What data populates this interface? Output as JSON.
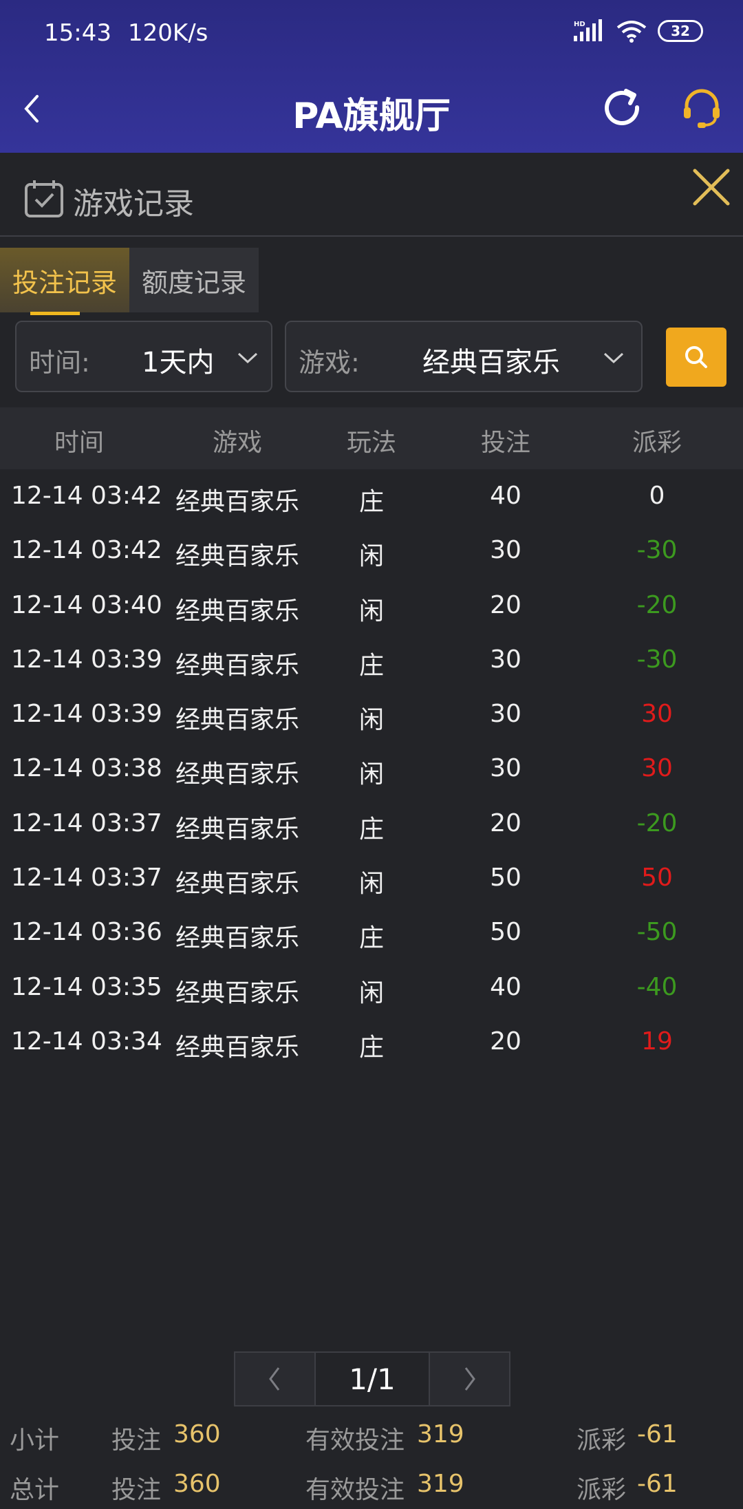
{
  "status_bar": {
    "time": "15:43",
    "network_speed": "120K/s",
    "battery": "32",
    "signal_badge": "HD"
  },
  "nav": {
    "title": "PA旗舰厅"
  },
  "section": {
    "title": "游戏记录"
  },
  "tabs": [
    {
      "label": "投注记录",
      "active": true
    },
    {
      "label": "额度记录",
      "active": false
    }
  ],
  "filters": {
    "time": {
      "label": "时间:",
      "value": "1天内"
    },
    "game": {
      "label": "游戏:",
      "value": "经典百家乐"
    }
  },
  "table": {
    "headers": [
      "时间",
      "游戏",
      "玩法",
      "投注",
      "派彩"
    ],
    "rows": [
      {
        "time": "12-14 03:42",
        "game": "经典百家乐",
        "play": "庄",
        "bet": "40",
        "payout": "0",
        "sign": "zero"
      },
      {
        "time": "12-14 03:42",
        "game": "经典百家乐",
        "play": "闲",
        "bet": "30",
        "payout": "-30",
        "sign": "neg"
      },
      {
        "time": "12-14 03:40",
        "game": "经典百家乐",
        "play": "闲",
        "bet": "20",
        "payout": "-20",
        "sign": "neg"
      },
      {
        "time": "12-14 03:39",
        "game": "经典百家乐",
        "play": "庄",
        "bet": "30",
        "payout": "-30",
        "sign": "neg"
      },
      {
        "time": "12-14 03:39",
        "game": "经典百家乐",
        "play": "闲",
        "bet": "30",
        "payout": "30",
        "sign": "pos"
      },
      {
        "time": "12-14 03:38",
        "game": "经典百家乐",
        "play": "闲",
        "bet": "30",
        "payout": "30",
        "sign": "pos"
      },
      {
        "time": "12-14 03:37",
        "game": "经典百家乐",
        "play": "庄",
        "bet": "20",
        "payout": "-20",
        "sign": "neg"
      },
      {
        "time": "12-14 03:37",
        "game": "经典百家乐",
        "play": "闲",
        "bet": "50",
        "payout": "50",
        "sign": "pos"
      },
      {
        "time": "12-14 03:36",
        "game": "经典百家乐",
        "play": "庄",
        "bet": "50",
        "payout": "-50",
        "sign": "neg"
      },
      {
        "time": "12-14 03:35",
        "game": "经典百家乐",
        "play": "闲",
        "bet": "40",
        "payout": "-40",
        "sign": "neg"
      },
      {
        "time": "12-14 03:34",
        "game": "经典百家乐",
        "play": "庄",
        "bet": "20",
        "payout": "19",
        "sign": "pos"
      }
    ]
  },
  "pager": {
    "label": "1/1"
  },
  "summary": {
    "subtotal": {
      "title": "小计",
      "bet_label": "投注",
      "bet": "360",
      "valid_label": "有效投注",
      "valid": "319",
      "payout_label": "派彩",
      "payout": "-61"
    },
    "total": {
      "title": "总计",
      "bet_label": "投注",
      "bet": "360",
      "valid_label": "有效投注",
      "valid": "319",
      "payout_label": "派彩",
      "payout": "-61"
    }
  },
  "colors": {
    "accent": "#f0a81e",
    "positive": "#e01b1b",
    "negative": "#3c9a1f",
    "header_bg": "#2b2a82"
  },
  "icons": [
    "back-arrow-icon",
    "refresh-icon",
    "headset-icon",
    "calendar-check-icon",
    "close-icon",
    "chevron-down-icon",
    "search-icon",
    "chevron-left-icon",
    "chevron-right-icon"
  ]
}
